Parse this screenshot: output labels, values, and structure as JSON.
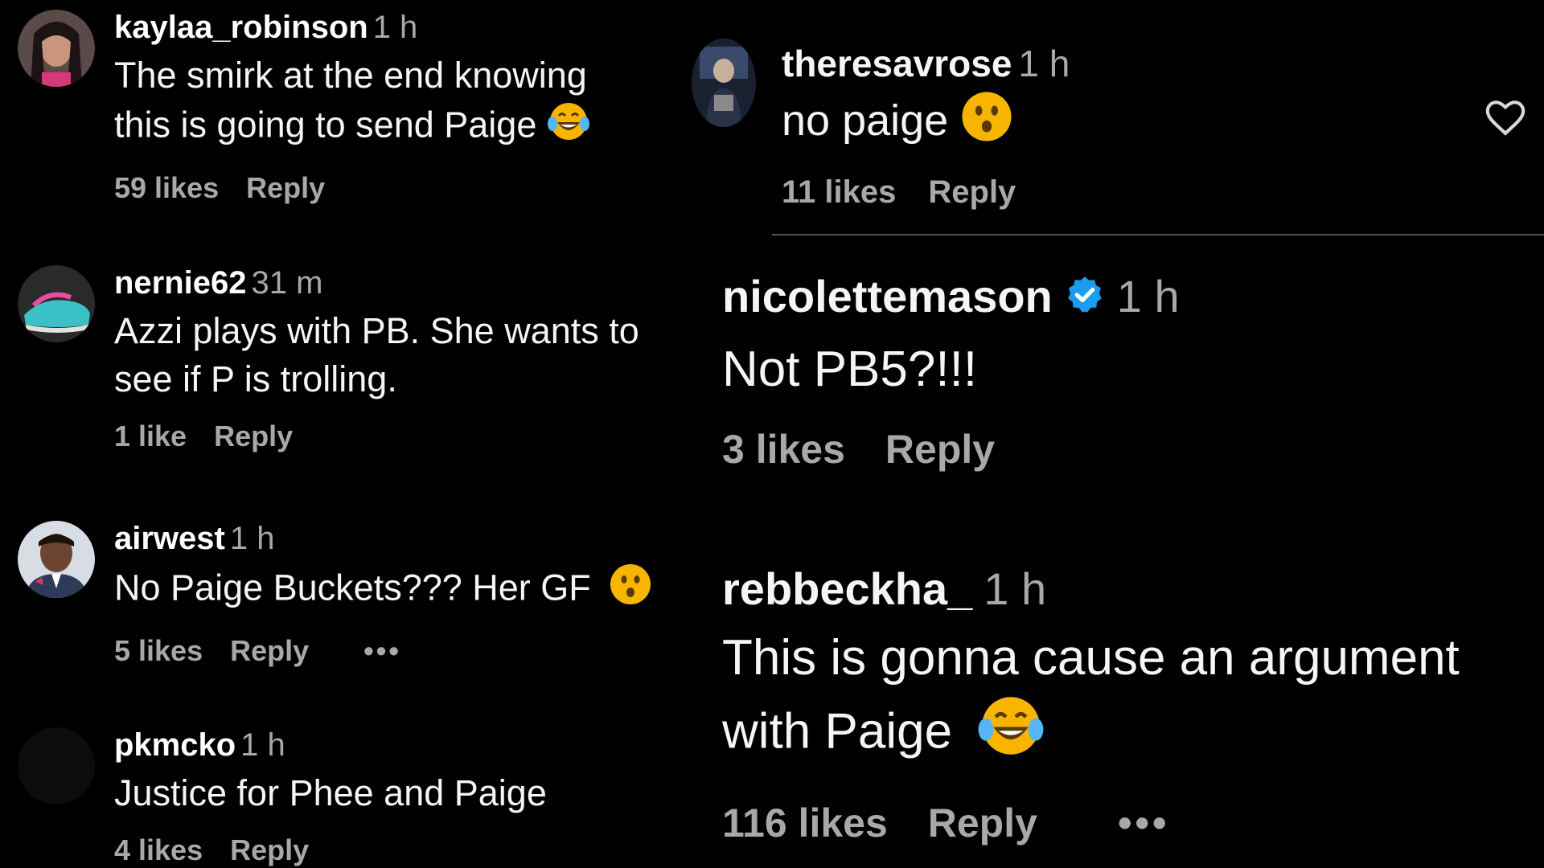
{
  "left_comments": [
    {
      "username": "kaylaa_robinson",
      "time": "1 h",
      "text_line1": "The smirk at the end knowing",
      "text_line2": "this is going to send Paige",
      "emoji": "laughing-tears-emoji",
      "likes": "59 likes",
      "reply": "Reply"
    },
    {
      "username": "nernie62",
      "time": "31 m",
      "text_line1": "Azzi plays with PB. She wants to",
      "text_line2": "see if P is trolling.",
      "likes": "1 like",
      "reply": "Reply"
    },
    {
      "username": "airwest",
      "time": "1 h",
      "text_line1": "No Paige Buckets??? Her GF",
      "emoji": "surprised-face-emoji",
      "likes": "5 likes",
      "reply": "Reply",
      "more": "•••"
    },
    {
      "username": "pkmcko",
      "time": "1 h",
      "text_line1": "Justice for Phee and Paige",
      "likes": "4 likes",
      "reply": "Reply"
    }
  ],
  "right_comments": [
    {
      "username": "theresavrose",
      "time": "1 h",
      "text_line1": "no paige",
      "emoji": "surprised-face-emoji",
      "likes": "11 likes",
      "reply": "Reply",
      "icon": "heart-outline-icon"
    },
    {
      "username": "nicolettemason",
      "verified": "verified-badge-icon",
      "time": "1 h",
      "text_line1": "Not PB5?!!!",
      "likes": "3 likes",
      "reply": "Reply"
    },
    {
      "username": "rebbeckha_",
      "time": "1 h",
      "text_line1": "This is gonna cause an argument",
      "text_line2": "with Paige",
      "emoji": "laughing-tears-emoji",
      "likes": "116 likes",
      "reply": "Reply",
      "more": "•••"
    }
  ],
  "colors": {
    "background": "#000000",
    "primary_text": "#f5f5f5",
    "secondary_text": "#a8a8a8",
    "verified_blue": "#1d9bf0",
    "emoji_yellow": "#f7b500"
  }
}
